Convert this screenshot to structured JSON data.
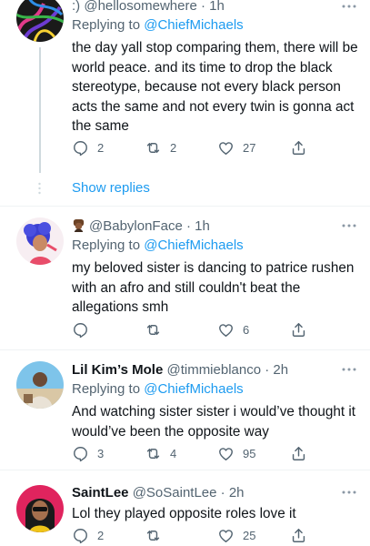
{
  "tweets": [
    {
      "name": "",
      "handle_prefix": ":) ",
      "handle": "@hellosomewhere",
      "time": " · 1h",
      "reply_prefix": "Replying to ",
      "reply_to": "@ChiefMichaels",
      "text": "the day yall stop comparing them, there will be world peace. and its time to drop the black stereotype, because not every black person acts the same and not every twin is gonna act the same",
      "replies": "2",
      "retweets": "2",
      "likes": "27"
    },
    {
      "name": "",
      "handle": "@BabylonFace",
      "time": " · 1h",
      "reply_prefix": "Replying to ",
      "reply_to": "@ChiefMichaels",
      "text": "my beloved sister is dancing to patrice rushen with an afro and still couldn't beat the allegations smh",
      "replies": "",
      "retweets": "",
      "likes": "6"
    },
    {
      "name": "Lil Kim’s Mole",
      "handle": "@timmieblanco",
      "time": " · 2h",
      "reply_prefix": "Replying to ",
      "reply_to": "@ChiefMichaels",
      "text": "And watching sister sister i would’ve thought it would’ve been the opposite way",
      "replies": "3",
      "retweets": "4",
      "likes": "95"
    },
    {
      "name": "SaintLee",
      "handle": "@SoSaintLee",
      "time": " · 2h",
      "text": "Lol they played opposite roles love it",
      "replies": "2",
      "retweets": "",
      "likes": "25"
    }
  ],
  "show_replies": "Show replies",
  "icons": {
    "reply": "reply-icon",
    "retweet": "retweet-icon",
    "like": "heart-icon",
    "share": "share-icon",
    "more": "more-icon"
  },
  "colors": {
    "link": "#1d9bf0",
    "secondary": "#536471",
    "text": "#0f1419"
  }
}
